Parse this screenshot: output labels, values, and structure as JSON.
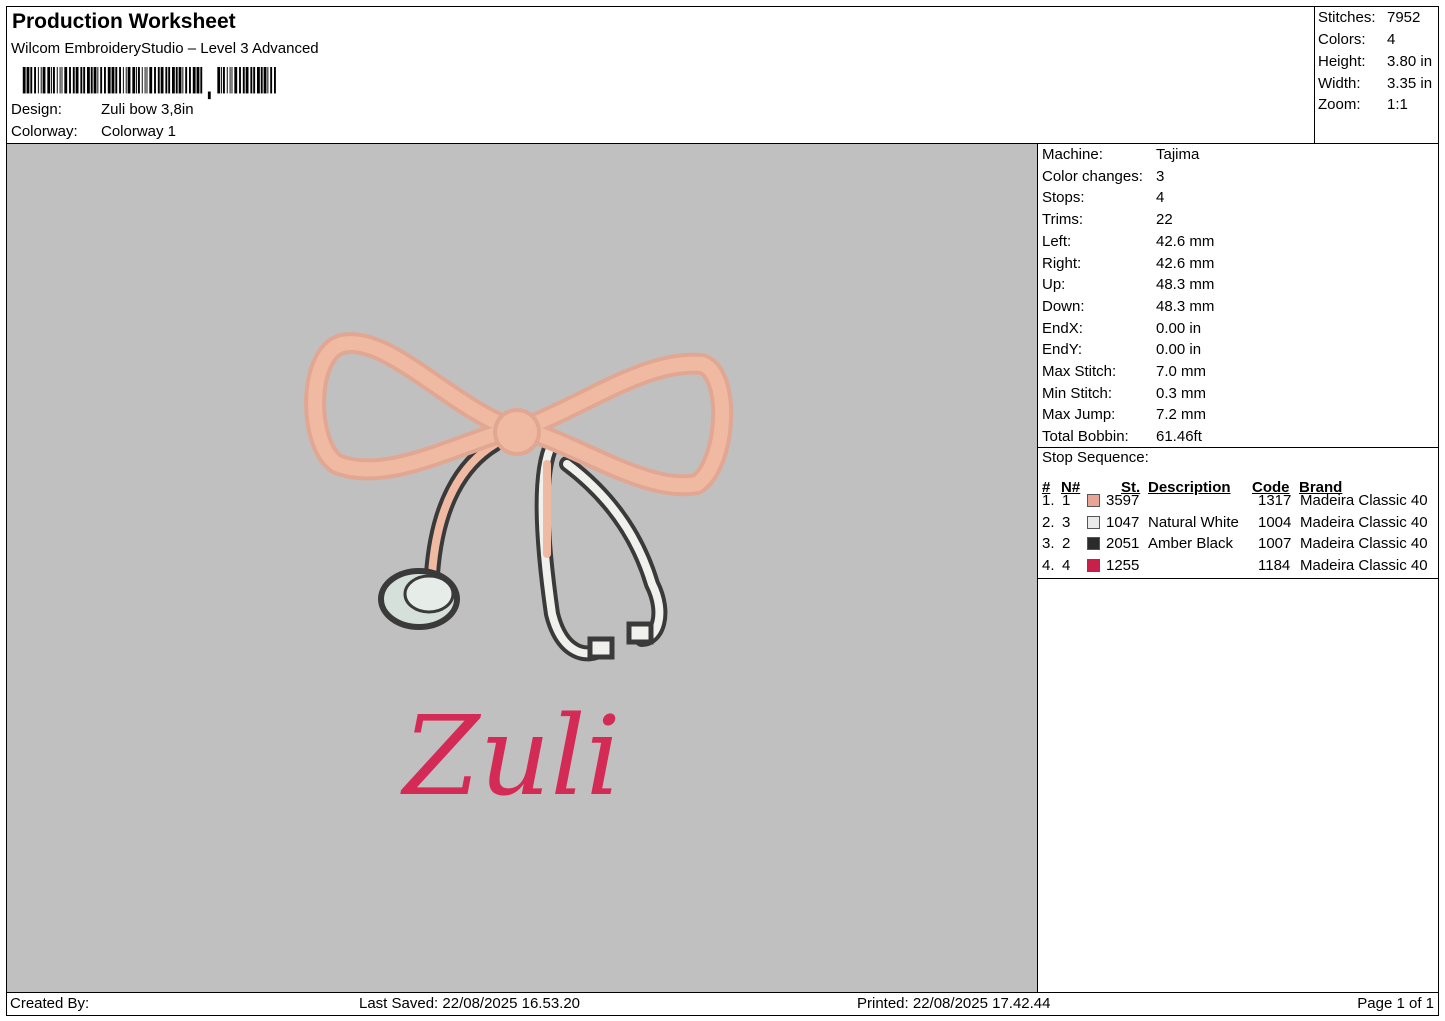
{
  "header": {
    "title": "Production Worksheet",
    "software": "Wilcom EmbroideryStudio – Level 3 Advanced",
    "design_label": "Design:",
    "design_value": "Zuli bow 3,8in",
    "colorway_label": "Colorway:",
    "colorway_value": "Colorway 1"
  },
  "summary": [
    {
      "label": "Stitches:",
      "value": "7952"
    },
    {
      "label": "Colors:",
      "value": "4"
    },
    {
      "label": "Height:",
      "value": "3.80 in"
    },
    {
      "label": "Width:",
      "value": "3.35 in"
    },
    {
      "label": "Zoom:",
      "value": "1:1"
    }
  ],
  "machine_info": [
    {
      "label": "Machine:",
      "value": "Tajima"
    },
    {
      "label": "Color changes:",
      "value": "3"
    },
    {
      "label": "Stops:",
      "value": "4"
    },
    {
      "label": "Trims:",
      "value": "22"
    },
    {
      "label": "Left:",
      "value": "42.6 mm"
    },
    {
      "label": "Right:",
      "value": "42.6 mm"
    },
    {
      "label": "Up:",
      "value": "48.3 mm"
    },
    {
      "label": "Down:",
      "value": "48.3 mm"
    },
    {
      "label": "EndX:",
      "value": "0.00 in"
    },
    {
      "label": "EndY:",
      "value": "0.00 in"
    },
    {
      "label": "Max Stitch:",
      "value": "7.0 mm"
    },
    {
      "label": "Min Stitch:",
      "value": "0.3 mm"
    },
    {
      "label": "Max Jump:",
      "value": "7.2 mm"
    },
    {
      "label": "Total Bobbin:",
      "value": "61.46ft"
    }
  ],
  "stop_sequence": {
    "title": "Stop Sequence:",
    "columns": {
      "idx": "#",
      "needle": "N#",
      "st": "St.",
      "description": "Description",
      "code": "Code",
      "brand": "Brand"
    },
    "rows": [
      {
        "idx": "1.",
        "needle": "1",
        "color": "#e8a595",
        "st": "3597",
        "description": "",
        "code": "1317",
        "brand": "Madeira Classic 40"
      },
      {
        "idx": "2.",
        "needle": "3",
        "color": "#eaeaea",
        "st": "1047",
        "description": "Natural White",
        "code": "1004",
        "brand": "Madeira Classic 40"
      },
      {
        "idx": "3.",
        "needle": "2",
        "color": "#2b2b2b",
        "st": "2051",
        "description": "Amber Black",
        "code": "1007",
        "brand": "Madeira Classic 40"
      },
      {
        "idx": "4.",
        "needle": "4",
        "color": "#c8204a",
        "st": "1255",
        "description": "",
        "code": "1184",
        "brand": "Madeira Classic 40"
      }
    ]
  },
  "preview": {
    "embroidered_text": "Zuli",
    "background_color": "#c0c0c0",
    "bow_color": "#f0b9a2",
    "text_color": "#d32b55",
    "outline_color": "#3a3a3a"
  },
  "footer": {
    "created_by": "Created By:",
    "last_saved": "Last Saved: 22/08/2025 16.53.20",
    "printed": "Printed: 22/08/2025 17.42.44",
    "page": "Page 1 of 1"
  }
}
